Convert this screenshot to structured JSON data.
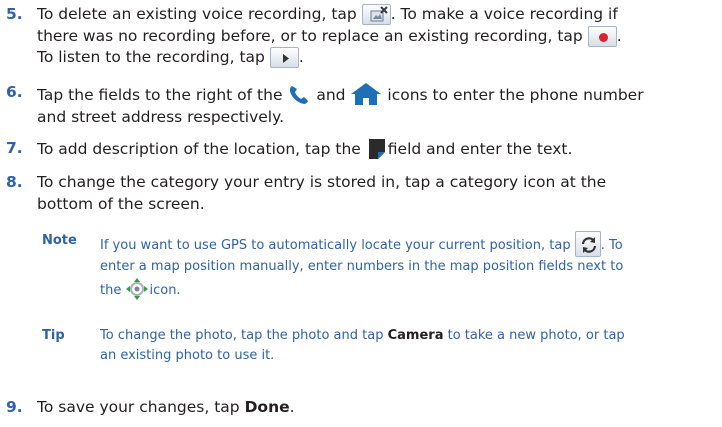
{
  "steps": [
    {
      "number": "5.",
      "lines": {
        "l1_a": "To delete an existing voice recording, tap",
        "l1_b": ". To make a voice recording if",
        "l2_a": "there was no recording before, or to replace an existing recording, tap",
        "l2_b": ".",
        "l3_a": "To listen to the recording, tap",
        "l3_b": "."
      }
    },
    {
      "number": "6.",
      "lines": {
        "l1_a": "Tap the fields to the right of the",
        "l1_b": "and",
        "l1_c": "icons to enter the phone number",
        "l2": "and street address respectively."
      }
    },
    {
      "number": "7.",
      "lines": {
        "l1_a": "To add description of the location, tap the",
        "l1_b": "field and enter the text."
      }
    },
    {
      "number": "8.",
      "lines": {
        "l1": "To change the category your entry is stored in, tap a category icon at the",
        "l2": "bottom of the screen."
      }
    },
    {
      "number": "9.",
      "lines": {
        "l1_a": "To save your changes, tap",
        "l1_bold": "Done",
        "l1_b": "."
      }
    }
  ],
  "note": {
    "label": "Note",
    "l1_a": "If you want to use GPS to automatically locate your current position, tap",
    "l1_b": ". To",
    "l2": "enter a map position manually, enter numbers in the map position fields next to",
    "l3_a": "the",
    "l3_b": "icon."
  },
  "tip": {
    "label": "Tip",
    "l1_a": "To change the photo, tap the photo and tap",
    "l1_bold": "Camera",
    "l1_b": "to take a new photo, or tap",
    "l2": "an existing photo to use it."
  },
  "colors": {
    "accent": "#2f62a8",
    "text": "#231f20",
    "record_red": "#d9232e",
    "icon_blue": "#1f6fb6"
  },
  "icons": {
    "delete_recording": "delete-recording-icon",
    "record": "record-icon",
    "play": "play-icon",
    "phone": "phone-icon",
    "home": "home-icon",
    "note": "note-page-icon",
    "gps": "gps-refresh-icon",
    "crosshair": "crosshair-icon"
  }
}
